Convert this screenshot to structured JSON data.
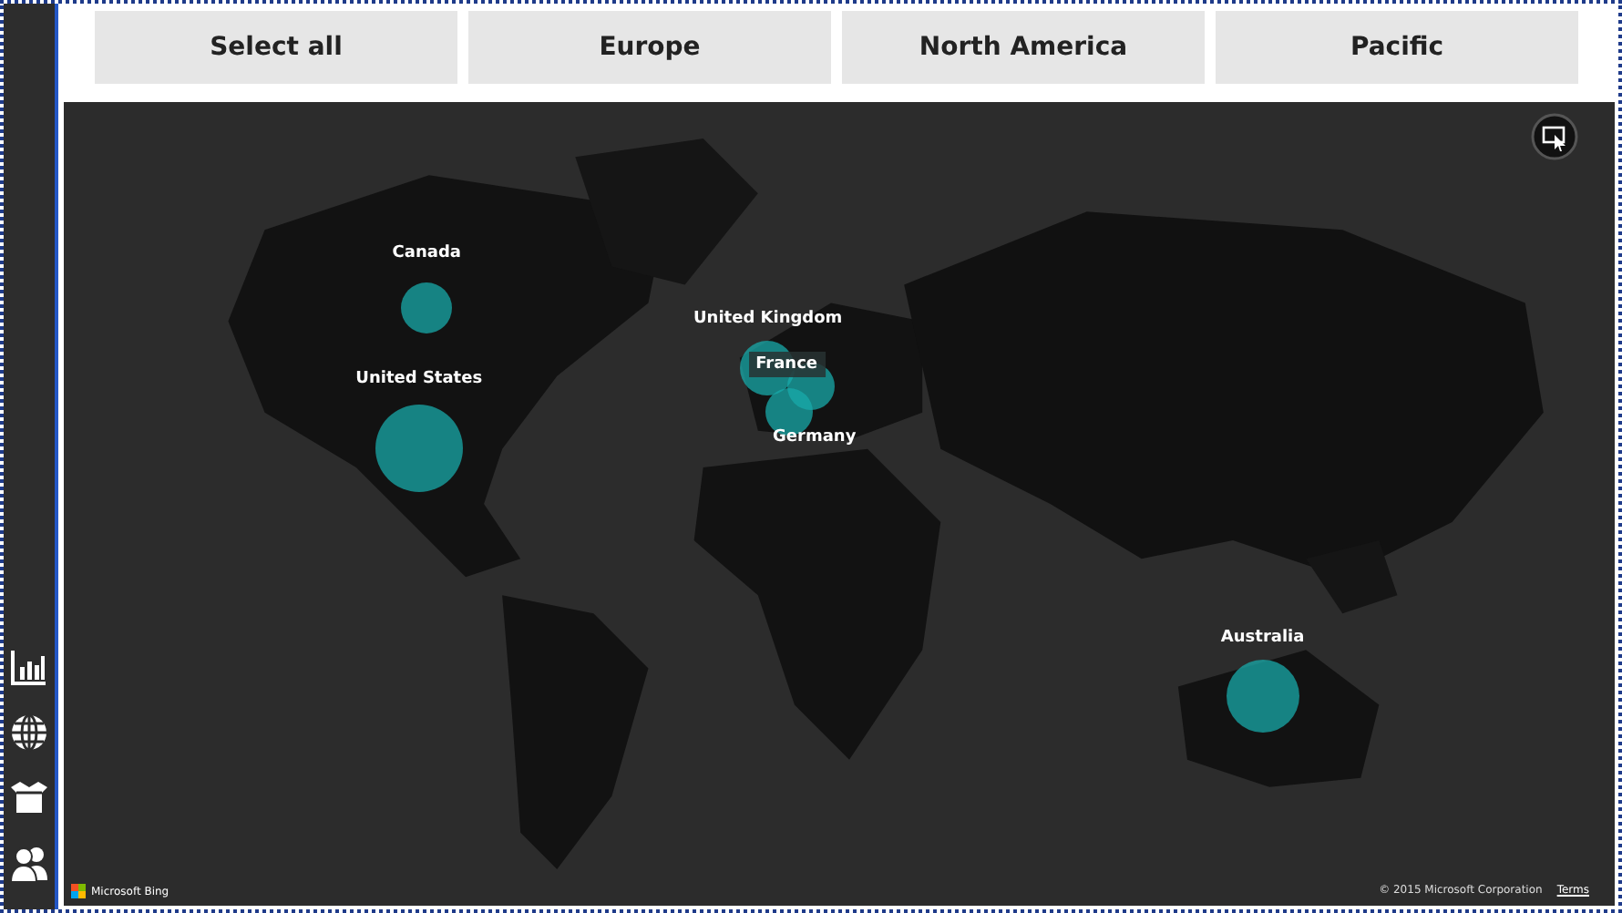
{
  "filter_buttons": [
    {
      "label": "Select all"
    },
    {
      "label": "Europe"
    },
    {
      "label": "North America"
    },
    {
      "label": "Pacific"
    }
  ],
  "map": {
    "bubbles": [
      {
        "label": "Canada",
        "boxed": false
      },
      {
        "label": "United States",
        "boxed": false
      },
      {
        "label": "United Kingdom",
        "boxed": false
      },
      {
        "label": "France",
        "boxed": true
      },
      {
        "label": "Germany",
        "boxed": false
      },
      {
        "label": "Australia",
        "boxed": false
      }
    ],
    "provider": "Microsoft Bing",
    "copyright": "© 2015 Microsoft Corporation",
    "terms_link": "Terms"
  }
}
